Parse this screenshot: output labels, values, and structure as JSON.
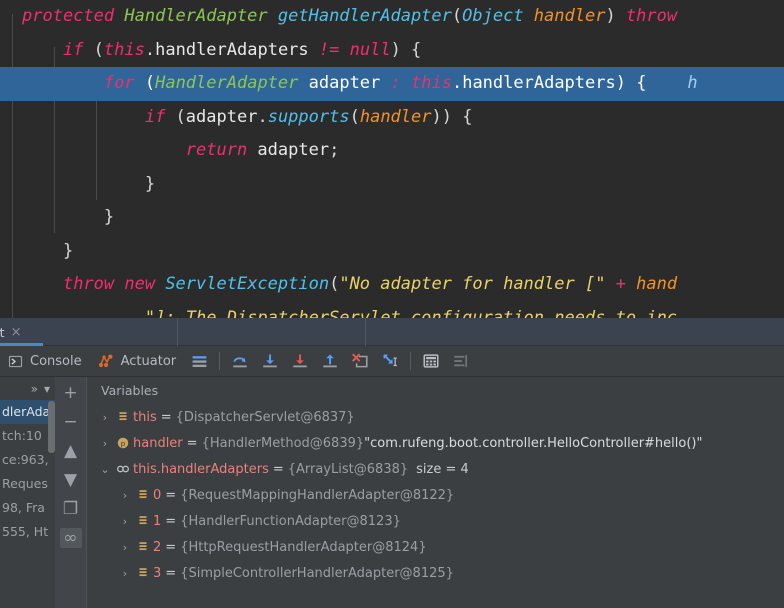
{
  "editor": {
    "lines": [
      [
        {
          "t": "protected ",
          "c": "kw"
        },
        {
          "t": "HandlerAdapter ",
          "c": "type"
        },
        {
          "t": "getHandlerAdapter",
          "c": "meth"
        },
        {
          "t": "(",
          "c": "punc"
        },
        {
          "t": "Object ",
          "c": "cls"
        },
        {
          "t": "handler",
          "c": "par"
        },
        {
          "t": ")",
          "c": "punc"
        },
        {
          "t": " throw",
          "c": "kw"
        }
      ],
      [
        {
          "t": "    ",
          "c": "plain"
        },
        {
          "t": "if ",
          "c": "kw"
        },
        {
          "t": "(",
          "c": "punc"
        },
        {
          "t": "this",
          "c": "kw"
        },
        {
          "t": ".",
          "c": "punc"
        },
        {
          "t": "handlerAdapters ",
          "c": "fld"
        },
        {
          "t": "!= ",
          "c": "kw"
        },
        {
          "t": "null",
          "c": "kw"
        },
        {
          "t": ") {",
          "c": "punc"
        }
      ],
      [
        {
          "t": "        ",
          "c": "plain"
        },
        {
          "t": "for ",
          "c": "kw"
        },
        {
          "t": "(",
          "c": "punc"
        },
        {
          "t": "HandlerAdapter ",
          "c": "type"
        },
        {
          "t": "adapter ",
          "c": "plain"
        },
        {
          "t": ": ",
          "c": "kw"
        },
        {
          "t": "this",
          "c": "kw"
        },
        {
          "t": ".",
          "c": "punc"
        },
        {
          "t": "handlerAdapters",
          "c": "fld"
        },
        {
          "t": ") {",
          "c": "punc"
        },
        {
          "t": "    h",
          "c": "hint"
        }
      ],
      [
        {
          "t": "            ",
          "c": "plain"
        },
        {
          "t": "if ",
          "c": "kw"
        },
        {
          "t": "(",
          "c": "punc"
        },
        {
          "t": "adapter",
          "c": "plain"
        },
        {
          "t": ".",
          "c": "punc"
        },
        {
          "t": "supports",
          "c": "meth"
        },
        {
          "t": "(",
          "c": "punc"
        },
        {
          "t": "handler",
          "c": "par"
        },
        {
          "t": ")) {",
          "c": "punc"
        }
      ],
      [
        {
          "t": "                ",
          "c": "plain"
        },
        {
          "t": "return ",
          "c": "kw"
        },
        {
          "t": "adapter",
          "c": "plain"
        },
        {
          "t": ";",
          "c": "punc"
        }
      ],
      [
        {
          "t": "            }",
          "c": "punc"
        }
      ],
      [
        {
          "t": "        }",
          "c": "punc"
        }
      ],
      [
        {
          "t": "    }",
          "c": "punc"
        }
      ],
      [
        {
          "t": "    ",
          "c": "plain"
        },
        {
          "t": "throw new ",
          "c": "kw"
        },
        {
          "t": "ServletException",
          "c": "cls"
        },
        {
          "t": "(",
          "c": "punc"
        },
        {
          "t": "\"No adapter for handler [\"",
          "c": "str"
        },
        {
          "t": " + ",
          "c": "kw"
        },
        {
          "t": "hand",
          "c": "par"
        }
      ],
      [
        {
          "t": "            ",
          "c": "plain"
        },
        {
          "t": "\"]: The DispatcherServlet configuration needs to inc",
          "c": "str"
        }
      ]
    ],
    "highlighted_line_index": 2
  },
  "debug": {
    "tab": {
      "label": "ot",
      "close": "×"
    },
    "toolbar": {
      "console_label": "Console",
      "actuator_label": "Actuator",
      "buttons": [
        "console-button",
        "actuator-button",
        "layout-settings-button",
        "step-over-button",
        "step-into-button",
        "force-step-into-button",
        "step-out-button",
        "drop-frame-button",
        "run-to-cursor-button",
        "evaluate-expression-button",
        "mute-breakpoints-button"
      ]
    },
    "frames": {
      "header_more": "»",
      "header_chevron": "▾",
      "rows": [
        {
          "text": "dlerAda",
          "selected": true
        },
        {
          "text": "tch:10",
          "selected": false
        },
        {
          "text": "ce:963,",
          "selected": false
        },
        {
          "text": "Reques",
          "selected": false
        },
        {
          "text": "98, Fra",
          "selected": false
        },
        {
          "text": "555, Ht",
          "selected": false
        }
      ]
    },
    "actions": [
      {
        "name": "add-watch-button",
        "glyph": "+",
        "active": false
      },
      {
        "name": "remove-watch-button",
        "glyph": "−",
        "active": false
      },
      {
        "name": "move-up-button",
        "glyph": "▲",
        "active": false
      },
      {
        "name": "move-down-button",
        "glyph": "▼",
        "active": false
      },
      {
        "name": "copy-value-button",
        "glyph": "❐",
        "active": false
      },
      {
        "name": "watches-toggle-button",
        "glyph": "∞",
        "active": true
      }
    ],
    "variables": {
      "header": "Variables",
      "rows": [
        {
          "twisty": "›",
          "icon": "field-icon",
          "indent": 0,
          "name": "this",
          "eq": "=",
          "type": "{DispatcherServlet@6837}",
          "str": "",
          "size": ""
        },
        {
          "twisty": "›",
          "icon": "parameter-icon",
          "indent": 0,
          "name": "handler",
          "eq": "=",
          "type": "{HandlerMethod@6839}",
          "str": "\"com.rufeng.boot.controller.HelloController#hello()\"",
          "size": ""
        },
        {
          "twisty": "⌄",
          "icon": "watch-icon",
          "indent": 0,
          "name": "this.handlerAdapters",
          "eq": "=",
          "type": "{ArrayList@6838}",
          "str": "",
          "size": "size = 4"
        },
        {
          "twisty": "›",
          "icon": "field-icon",
          "indent": 1,
          "name": "0",
          "eq": "=",
          "type": "{RequestMappingHandlerAdapter@8122}",
          "str": "",
          "size": ""
        },
        {
          "twisty": "›",
          "icon": "field-icon",
          "indent": 1,
          "name": "1",
          "eq": "=",
          "type": "{HandlerFunctionAdapter@8123}",
          "str": "",
          "size": ""
        },
        {
          "twisty": "›",
          "icon": "field-icon",
          "indent": 1,
          "name": "2",
          "eq": "=",
          "type": "{HttpRequestHandlerAdapter@8124}",
          "str": "",
          "size": ""
        },
        {
          "twisty": "›",
          "icon": "field-icon",
          "indent": 1,
          "name": "3",
          "eq": "=",
          "type": "{SimpleControllerHandlerAdapter@8125}",
          "str": "",
          "size": ""
        }
      ]
    }
  },
  "colors": {
    "editor_bg": "#2b2b2b",
    "selection": "#2f6599",
    "keyword": "#ef2e6e",
    "type": "#8cc752",
    "method": "#4fc1e9",
    "string": "#e8d26a",
    "parameter": "#f0932b",
    "panel_bg": "#3c3f41",
    "tab_bg": "#3c4350",
    "accent": "#4a88c7",
    "var_name": "#e8827c"
  }
}
